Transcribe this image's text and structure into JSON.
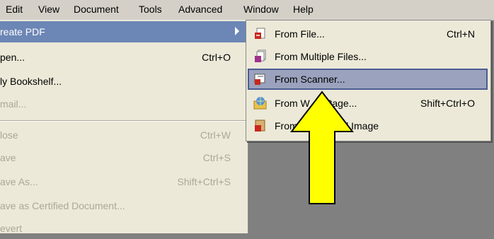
{
  "menubar": {
    "items": [
      "Edit",
      "View",
      "Document",
      "Tools",
      "Advanced",
      "Window",
      "Help"
    ]
  },
  "file_menu": {
    "items": [
      {
        "label": "reate PDF",
        "shortcut": "",
        "state": "highlight",
        "has_submenu": true
      },
      {
        "label": "pen...",
        "shortcut": "Ctrl+O",
        "state": "normal"
      },
      {
        "label": "ly Bookshelf...",
        "shortcut": "",
        "state": "normal"
      },
      {
        "label": "mail...",
        "shortcut": "",
        "state": "disabled"
      },
      {
        "label": "lose",
        "shortcut": "Ctrl+W",
        "state": "disabled"
      },
      {
        "label": "ave",
        "shortcut": "Ctrl+S",
        "state": "disabled"
      },
      {
        "label": "ave As...",
        "shortcut": "Shift+Ctrl+S",
        "state": "disabled"
      },
      {
        "label": "ave as Certified Document...",
        "shortcut": "",
        "state": "disabled"
      },
      {
        "label": "evert",
        "shortcut": "",
        "state": "disabled"
      }
    ]
  },
  "submenu": {
    "items": [
      {
        "label": "From File...",
        "shortcut": "Ctrl+N",
        "icon": "pdf-file-icon"
      },
      {
        "label": "From Multiple Files...",
        "shortcut": "",
        "icon": "pdf-multiple-files-icon"
      },
      {
        "label": "From Scanner...",
        "shortcut": "",
        "icon": "scanner-icon",
        "state": "highlight"
      },
      {
        "label": "From W",
        "label_end": "Page...",
        "shortcut": "Shift+Ctrl+O",
        "icon": "web-page-icon"
      },
      {
        "label": "From",
        "label_end": "ard Image",
        "shortcut": "",
        "icon": "clipboard-image-icon"
      }
    ]
  },
  "colors": {
    "menu_bg": "#ece9d8",
    "highlight": "#6c86b5",
    "submenu_highlight": "#9aa2bd",
    "arrow_fill": "#ffff00"
  }
}
